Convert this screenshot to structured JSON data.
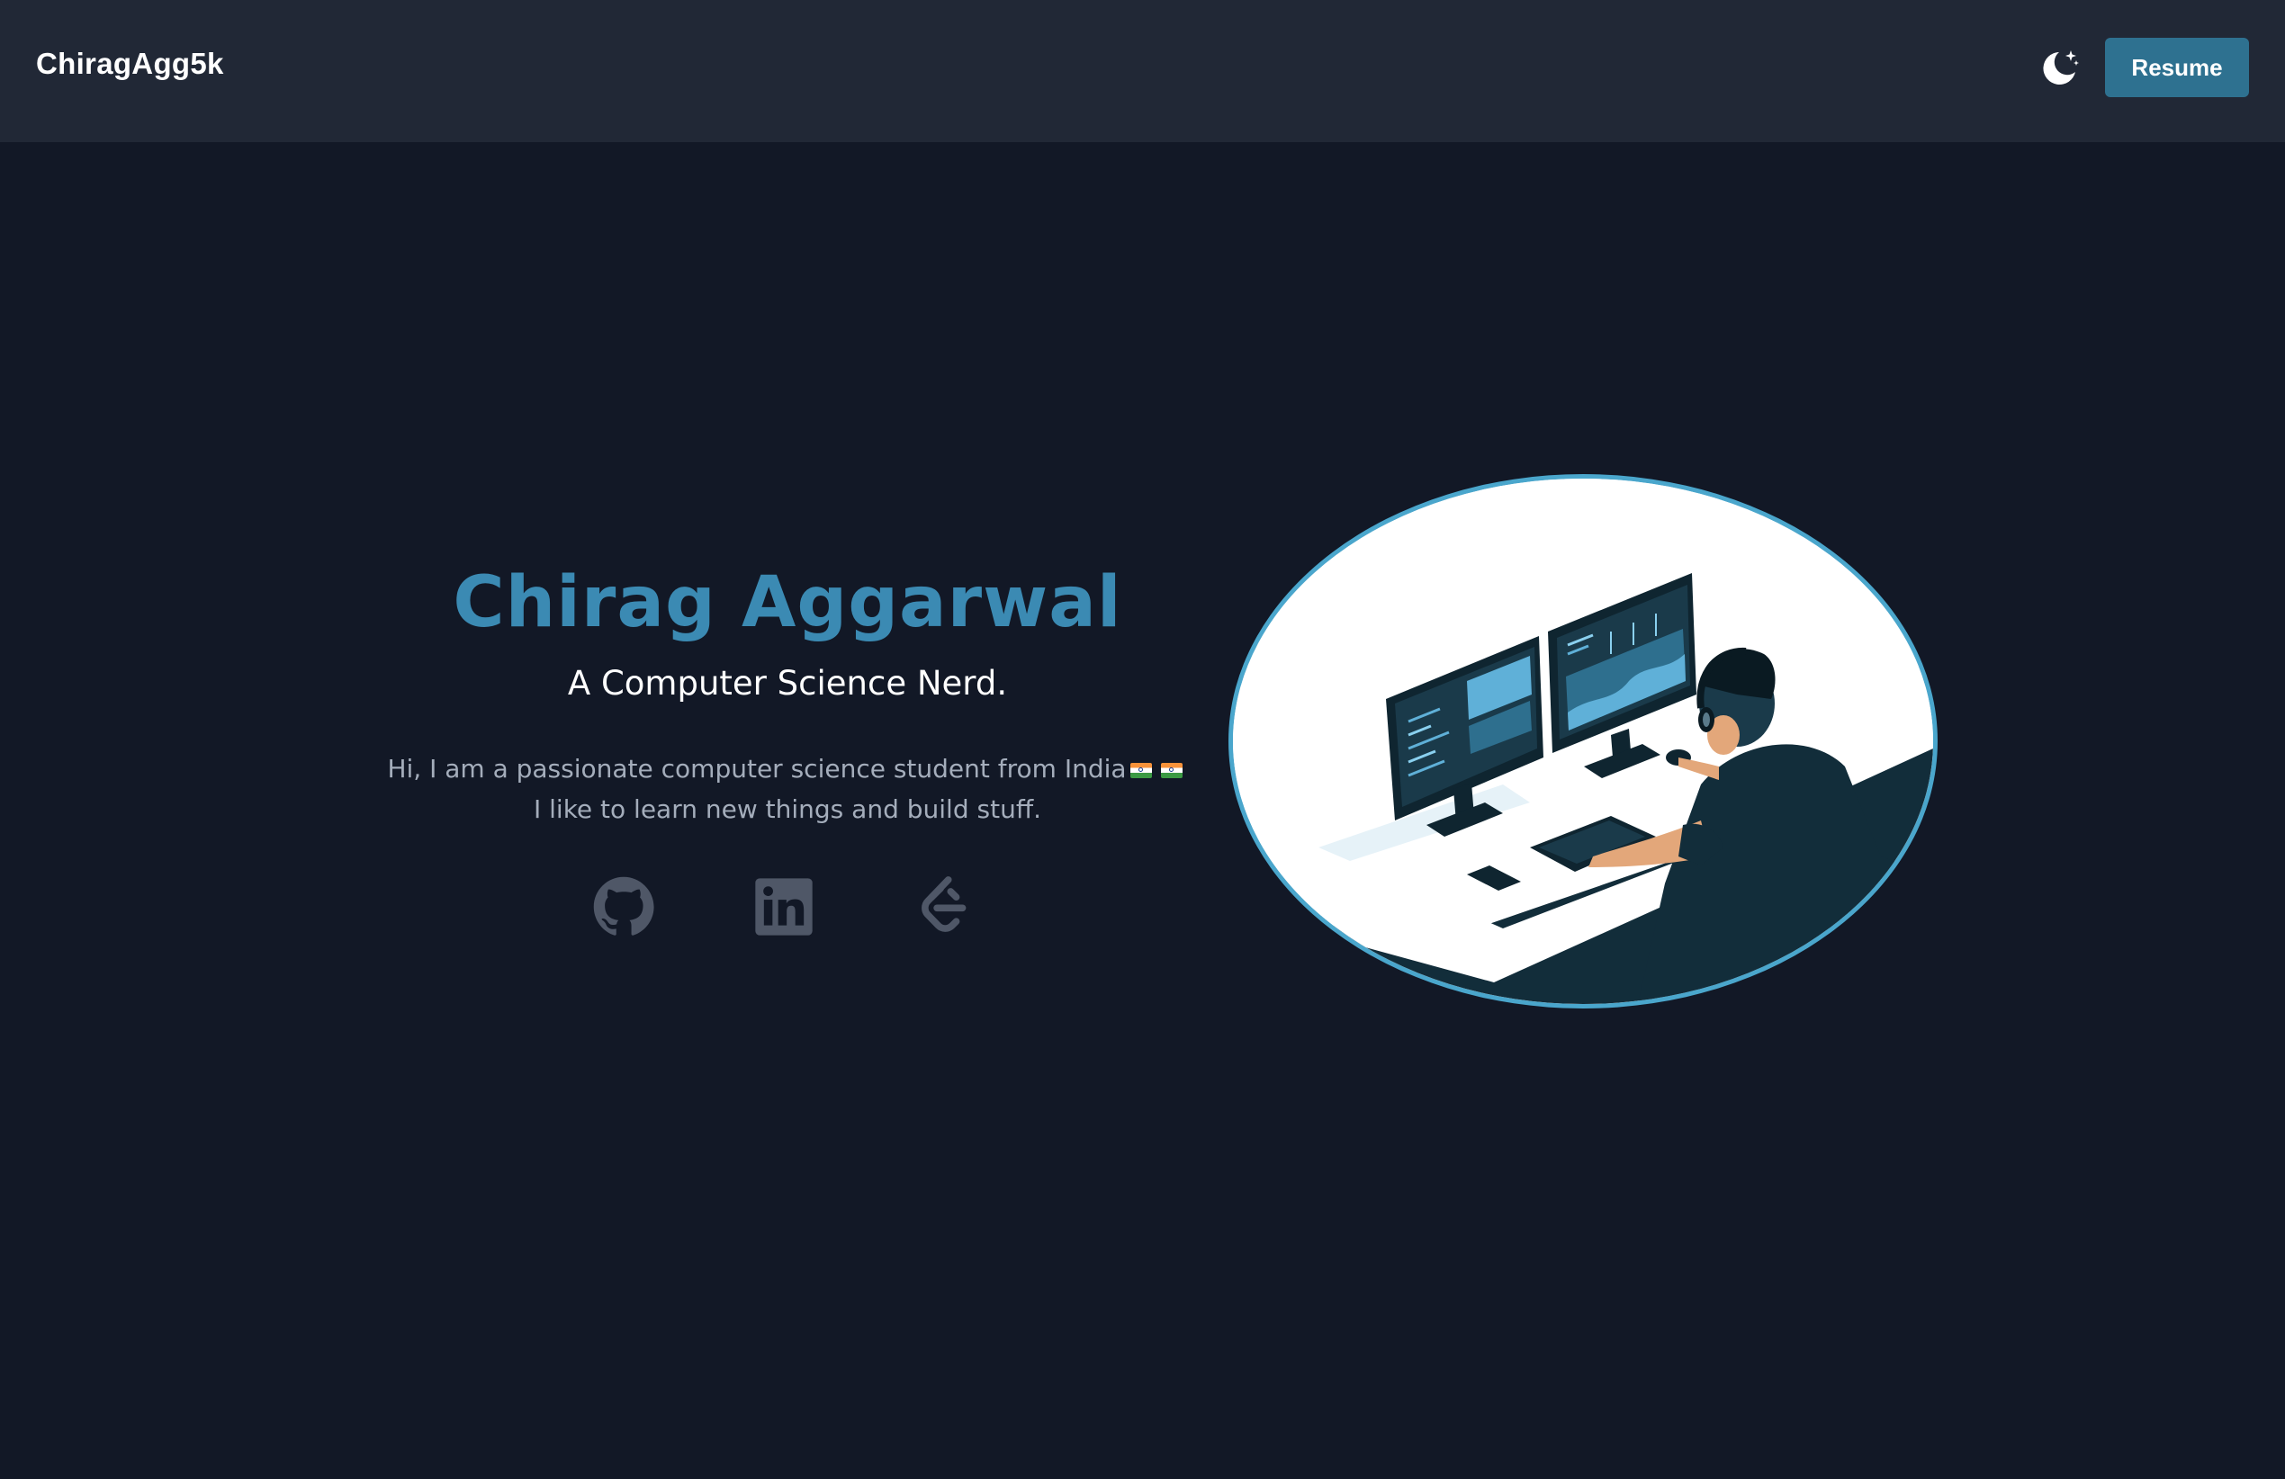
{
  "navbar": {
    "brand": "ChiragAgg5k",
    "theme_toggle_icon": "moon-stars-icon",
    "resume_label": "Resume"
  },
  "hero": {
    "name": "Chirag Aggarwal",
    "subtitle": "A Computer Science Nerd.",
    "description_line1": "Hi, I am a passionate computer science student from India",
    "description_line2": "I like to learn new things and build stuff.",
    "flag_icon": "india-flag-icon"
  },
  "socials": [
    {
      "name": "GitHub",
      "icon": "github-icon"
    },
    {
      "name": "LinkedIn",
      "icon": "linkedin-icon"
    },
    {
      "name": "LeetCode",
      "icon": "leetcode-icon"
    }
  ],
  "illustration": {
    "icon": "developer-at-desk-illustration"
  },
  "colors": {
    "background": "#121826",
    "navbar": "#212836",
    "accent": "#3b8ab3",
    "button": "#2e7190",
    "muted_text": "#a4adbb",
    "icon_gray": "#4f5767"
  }
}
